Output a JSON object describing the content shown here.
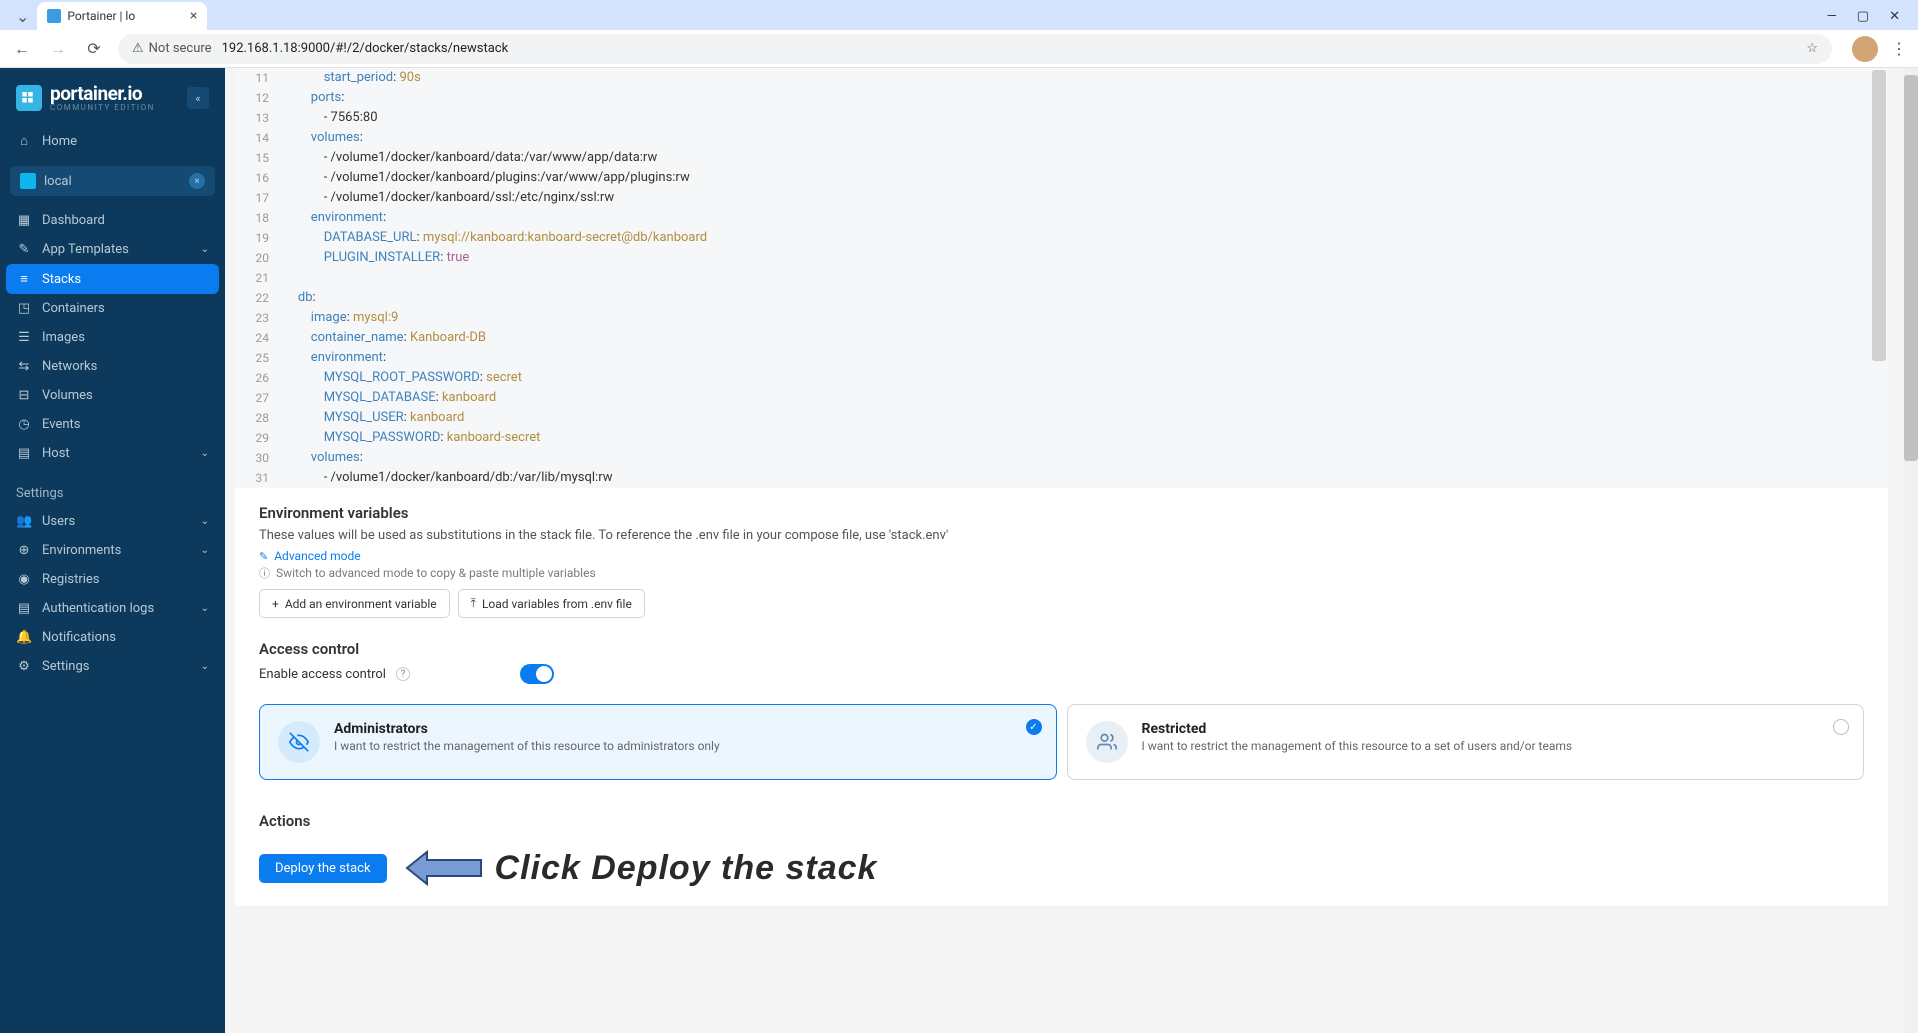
{
  "browser": {
    "tab_title": "Portainer | lo",
    "security_label": "Not secure",
    "url": "192.168.1.18:9000/#!/2/docker/stacks/newstack"
  },
  "sidebar": {
    "logo_text": "portainer.io",
    "logo_subtitle": "COMMUNITY EDITION",
    "home_label": "Home",
    "env_name": "local",
    "items": [
      {
        "icon": "dashboard",
        "label": "Dashboard"
      },
      {
        "icon": "edit",
        "label": "App Templates",
        "expandable": true
      },
      {
        "icon": "layers",
        "label": "Stacks",
        "active": true
      },
      {
        "icon": "box",
        "label": "Containers"
      },
      {
        "icon": "list",
        "label": "Images"
      },
      {
        "icon": "share",
        "label": "Networks"
      },
      {
        "icon": "db",
        "label": "Volumes"
      },
      {
        "icon": "clock",
        "label": "Events"
      },
      {
        "icon": "server",
        "label": "Host",
        "expandable": true
      }
    ],
    "settings_title": "Settings",
    "settings_items": [
      {
        "icon": "users",
        "label": "Users",
        "expandable": true
      },
      {
        "icon": "globe",
        "label": "Environments",
        "expandable": true
      },
      {
        "icon": "radio",
        "label": "Registries"
      },
      {
        "icon": "file",
        "label": "Authentication logs",
        "expandable": true
      },
      {
        "icon": "bell",
        "label": "Notifications"
      },
      {
        "icon": "gear",
        "label": "Settings",
        "expandable": true
      }
    ]
  },
  "editor": {
    "lines": [
      {
        "n": 11,
        "indent": 6,
        "key": "start_period",
        "val": "90s"
      },
      {
        "n": 12,
        "indent": 4,
        "key": "ports",
        "val": ""
      },
      {
        "n": 13,
        "indent": 6,
        "raw": "- 7565:80"
      },
      {
        "n": 14,
        "indent": 4,
        "key": "volumes",
        "val": ""
      },
      {
        "n": 15,
        "indent": 6,
        "raw": "- /volume1/docker/kanboard/data:/var/www/app/data:rw"
      },
      {
        "n": 16,
        "indent": 6,
        "raw": "- /volume1/docker/kanboard/plugins:/var/www/app/plugins:rw"
      },
      {
        "n": 17,
        "indent": 6,
        "raw": "- /volume1/docker/kanboard/ssl:/etc/nginx/ssl:rw"
      },
      {
        "n": 18,
        "indent": 4,
        "key": "environment",
        "val": ""
      },
      {
        "n": 19,
        "indent": 6,
        "key": "DATABASE_URL",
        "val": "mysql://kanboard:kanboard-secret@db/kanboard"
      },
      {
        "n": 20,
        "indent": 6,
        "key": "PLUGIN_INSTALLER",
        "bool": "true"
      },
      {
        "n": 21,
        "indent": 0,
        "raw": ""
      },
      {
        "n": 22,
        "indent": 2,
        "key": "db",
        "val": ""
      },
      {
        "n": 23,
        "indent": 4,
        "key": "image",
        "val": "mysql:9"
      },
      {
        "n": 24,
        "indent": 4,
        "key": "container_name",
        "val": "Kanboard-DB"
      },
      {
        "n": 25,
        "indent": 4,
        "key": "environment",
        "val": ""
      },
      {
        "n": 26,
        "indent": 6,
        "key": "MYSQL_ROOT_PASSWORD",
        "val": "secret"
      },
      {
        "n": 27,
        "indent": 6,
        "key": "MYSQL_DATABASE",
        "val": "kanboard"
      },
      {
        "n": 28,
        "indent": 6,
        "key": "MYSQL_USER",
        "val": "kanboard"
      },
      {
        "n": 29,
        "indent": 6,
        "key": "MYSQL_PASSWORD",
        "val": "kanboard-secret"
      },
      {
        "n": 30,
        "indent": 4,
        "key": "volumes",
        "val": ""
      },
      {
        "n": 31,
        "indent": 6,
        "raw": "- /volume1/docker/kanboard/db:/var/lib/mysql:rw"
      }
    ]
  },
  "env_section": {
    "title": "Environment variables",
    "desc": "These values will be used as substitutions in the stack file. To reference the .env file in your compose file, use 'stack.env'",
    "advanced_link": "Advanced mode",
    "hint": "Switch to advanced mode to copy & paste multiple variables",
    "add_btn": "Add an environment variable",
    "load_btn": "Load variables from .env file"
  },
  "access_section": {
    "title": "Access control",
    "enable_label": "Enable access control",
    "admins_title": "Administrators",
    "admins_desc": "I want to restrict the management of this resource to administrators only",
    "restricted_title": "Restricted",
    "restricted_desc": "I want to restrict the management of this resource to a set of users and/or teams"
  },
  "actions_section": {
    "title": "Actions",
    "deploy_btn": "Deploy the stack",
    "annotation": "Click Deploy the stack"
  }
}
